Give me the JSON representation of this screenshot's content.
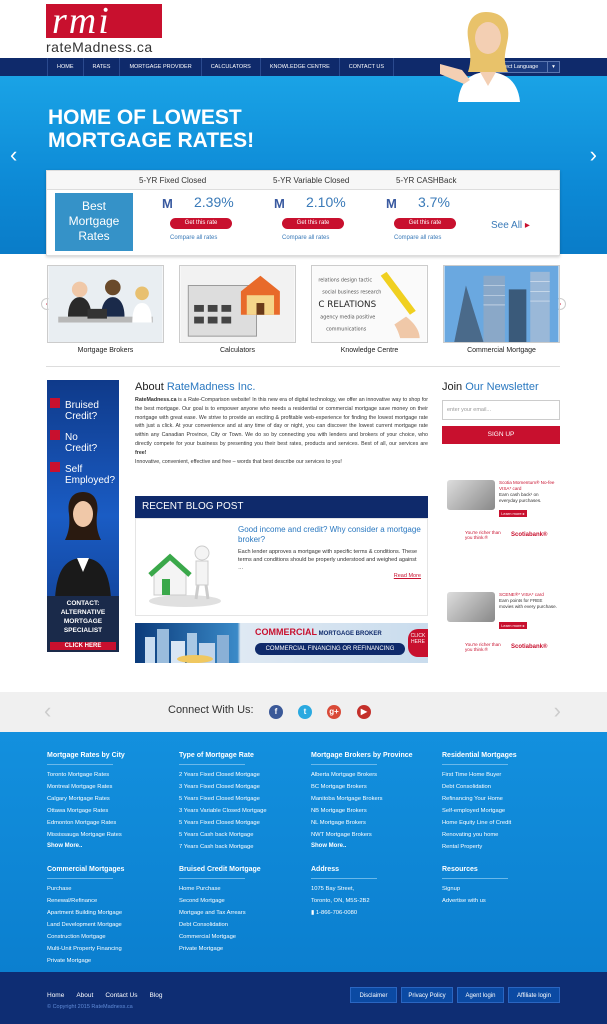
{
  "logo": {
    "mark": "rmi",
    "site_name": "rateMadness.ca"
  },
  "nav": {
    "items": [
      "HOME",
      "RATES",
      "MORTGAGE PROVIDER",
      "CALCULATORS",
      "KNOWLEDGE CENTRE",
      "CONTACT US"
    ],
    "language_select": "Select Language"
  },
  "hero": {
    "title_line1": "HOME OF LOWEST",
    "title_line2": "MORTGAGE RATES!"
  },
  "rates": {
    "box_label_1": "Best",
    "box_label_2": "Mortgage",
    "box_label_3": "Rates",
    "columns": [
      {
        "header": "5-YR Fixed Closed",
        "rate": "2.39%",
        "button": "Get this rate",
        "compare": "Compare all rates"
      },
      {
        "header": "5-YR Variable Closed",
        "rate": "2.10%",
        "button": "Get this rate",
        "compare": "Compare all rates"
      },
      {
        "header": "5-YR CASHBack",
        "rate": "3.7%",
        "button": "Get this rate",
        "compare": "Compare all rates"
      }
    ],
    "provider_mark": "M",
    "see_all": "See All"
  },
  "tiles": [
    "Mortgage Brokers",
    "Calculators",
    "Knowledge Centre",
    "Commercial Mortgage"
  ],
  "left_banner": {
    "q1a": "Bruised",
    "q1b": "Credit?",
    "q2a": "No",
    "q2b": "Credit?",
    "q3a": "Self",
    "q3b": "Employed?",
    "contact": "CONTACT:",
    "l1": "ALTERNATIVE",
    "l2": "MORTGAGE",
    "l3": "SPECIALIST",
    "click": "CLICK HERE"
  },
  "about": {
    "heading_prefix": "About ",
    "heading_brand": "RateMadness Inc.",
    "lead": "RateMadness.ca",
    "body": " is a Rate-Comparison website! In this new era of digital technology, we offer an innovative way to shop for the best mortgage. Our goal is to empower anyone who needs a residential or commercial mortgage save money on their mortgage with great ease. We strive to provide an exciting & profitable web-experience for finding the lowest mortgage rate with just a click. At your convenience and at any time of day or night, you can discover the lowest current mortgage rate within any Canadian Province, City or Town. We do so by connecting you with lenders and brokers of your choice, who directly compete for your business by presenting you their best rates, products and services. Best of all, our services are ",
    "free": "free!",
    "tagline": "Innovative, convenient, effective and free – words that best describe our services to you!"
  },
  "blog": {
    "heading": "RECENT BLOG POST",
    "title": "Good income and credit? Why consider a mortgage broker?",
    "excerpt": "Each lender approves a mortgage with specific terms & conditions. These terms and conditions should be properly understood and weighed against …",
    "read_more": "Read More"
  },
  "commercial_banner": {
    "title_a": "COMMERCIAL",
    "title_b": " MORTGAGE BROKER",
    "sub": "COMMERCIAL FINANCING  OR  REFINANCING",
    "click": "CLICK HERE"
  },
  "newsletter": {
    "heading_prefix": "Join ",
    "heading_brand": "Our Newsletter",
    "placeholder": "enter your email...",
    "button": "SIGN UP"
  },
  "ads": [
    {
      "title": "Scotia Momentum® No-fee VISA* card",
      "body": "Earn cash back¹ on everyday purchases.",
      "btn": "Learn more ▸",
      "yr": "You're richer than you think.®",
      "bank": "Scotiabank®"
    },
    {
      "title": "SCENE®* VISA* card",
      "body": "Earn points for FREE movies with every purchase.",
      "btn": "Learn more ▸",
      "yr": "You're richer than you think.®",
      "bank": "Scotiabank®"
    }
  ],
  "connect": {
    "label": "Connect With Us:",
    "social": [
      {
        "name": "facebook",
        "glyph": "f",
        "color": "#3b5998"
      },
      {
        "name": "twitter",
        "glyph": "t",
        "color": "#2aa9e0"
      },
      {
        "name": "googleplus",
        "glyph": "g+",
        "color": "#d94a38"
      },
      {
        "name": "youtube",
        "glyph": "▶",
        "color": "#c4302b"
      }
    ]
  },
  "footer": {
    "columns": [
      {
        "heading": "Mortgage Rates by City",
        "items": [
          "Toronto Mortgage Rates",
          "Montreal Mortgage Rates",
          "Calgary Mortgage Rates",
          "Ottawa Mortgage Rates",
          "Edmonton Mortgage Rates",
          "Mississauga Mortgage Rates"
        ],
        "more": "Show More.."
      },
      {
        "heading": "Type of Mortgage Rate",
        "items": [
          "2 Years Fixed Closed Mortgage",
          "3 Years Fixed Closed Mortgage",
          "5 Years Fixed Closed Mortgage",
          "3 Years Variable Closed Mortgage",
          "5 Years Fixed Closed Mortgage",
          "5 Years Cash back Mortgage",
          "7 Years Cash back Mortgage"
        ],
        "more": ""
      },
      {
        "heading": "Mortgage Brokers by Province",
        "items": [
          "Alberta Mortgage Brokers",
          "BC Mortgage Brokers",
          "Manitoba Mortgage Brokers",
          "NB Mortgage Brokers",
          "NL Mortgage Brokers",
          "NWT Mortgage Brokers"
        ],
        "more": "Show More.."
      },
      {
        "heading": "Residential Mortgages",
        "items": [
          "First Time Home Buyer",
          "Debt Consolidation",
          "Refinancing Your Home",
          "Self-employed Mortgage",
          "Home Equity Line of Credit",
          "Renovating you home",
          "Rental Property"
        ],
        "more": ""
      },
      {
        "heading": "Commercial Mortgages",
        "items": [
          "Purchase",
          "Renewal/Refinance",
          "Apartment Building Mortgage",
          "Land Development Mortgage",
          "Construction Mortgage",
          "Multi-Unit Property Financing",
          "Private Mortgage"
        ],
        "more": ""
      },
      {
        "heading": "Bruised Credit Mortgage",
        "items": [
          "Home Purchase",
          "Second Mortgage",
          "Mortgage and Tax Arrears",
          "Debt Consolidation",
          "Commercial Mortgage",
          "Private Mortgage"
        ],
        "more": ""
      },
      {
        "heading": "Address",
        "items": [
          "1075 Bay Street,",
          "Toronto, ON, M5S-2B2",
          "1-866-706-0080"
        ],
        "more": ""
      },
      {
        "heading": "Resources",
        "items": [
          "Signup",
          "Advertise with us"
        ],
        "more": ""
      }
    ]
  },
  "bottom": {
    "links": [
      "Home",
      "About",
      "Contact Us",
      "Blog"
    ],
    "copyright": "© Copyright 2015 RateMadness.ca",
    "buttons": [
      "Disclaimer",
      "Privacy Policy",
      "Agent login",
      "Affiliate login"
    ]
  }
}
